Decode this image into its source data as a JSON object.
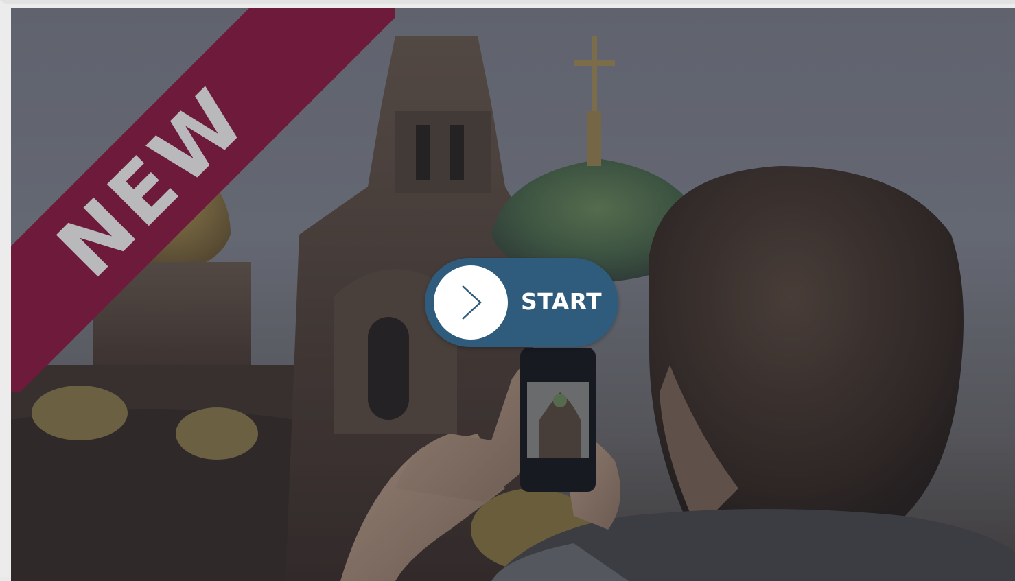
{
  "badge": {
    "label": "NEW",
    "color": "#6e1a3a"
  },
  "start_button": {
    "label": "START",
    "color": "#2f5c7c",
    "icon": "chevron-right-icon"
  },
  "scene": {
    "description_icon": "photo-background"
  }
}
